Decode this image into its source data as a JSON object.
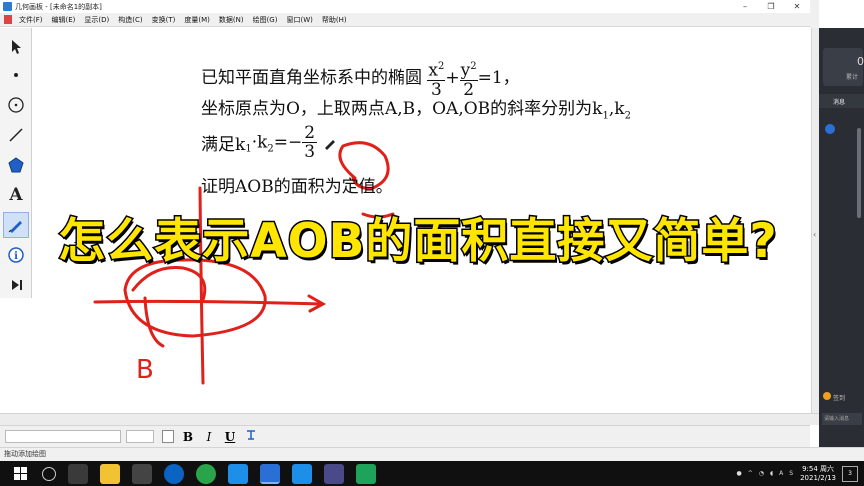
{
  "window": {
    "title": "几何画板 - [未命名1的副本]",
    "controls": [
      "–",
      "❐",
      "✕"
    ]
  },
  "menu": [
    "文件(F)",
    "编辑(E)",
    "显示(D)",
    "构造(C)",
    "变换(T)",
    "度量(M)",
    "数据(N)",
    "绘图(G)",
    "窗口(W)",
    "帮助(H)"
  ],
  "toolbox": {
    "tools": [
      "arrow-select",
      "point",
      "compass-circle",
      "straightedge",
      "polygon",
      "text",
      "marker",
      "information",
      "custom-tools"
    ],
    "active": "marker"
  },
  "problem": {
    "line1": {
      "prefix": "已知平面直角坐标系中的椭圆",
      "frac1_num": "x",
      "frac1_sup": "2",
      "frac1_den": "3",
      "plus": "+",
      "frac2_num": "y",
      "frac2_sup": "2",
      "frac2_den": "2",
      "suffix": "=1，"
    },
    "line2": {
      "text": "坐标原点为O，上取两点A,B，OA,OB的斜率分别为k",
      "sub1": "1",
      "comma": ",k",
      "sub2": "2"
    },
    "line3": {
      "prefix": "满足k",
      "sub1": "1",
      "mid": "·k",
      "sub2": "2",
      "eq": "=−",
      "frac_num": "2",
      "frac_den": "3"
    },
    "line4": "证明AOB的面积为定值。"
  },
  "banner": "怎么表示AOB的面积直接又简单?",
  "sketch": {
    "label": "B",
    "stroke_color": "#e0201a"
  },
  "textbar": {
    "bold": "B",
    "italic": "I",
    "underline": "U"
  },
  "status": "拖动添加绘图",
  "side_panel": {
    "big_number": "0",
    "subtitle": "累计",
    "tab": "消息",
    "sign_in": "签到",
    "input_placeholder": "请输入消息"
  },
  "taskbar": {
    "clock_time": "9:54 周六",
    "clock_date": "2021/2/13",
    "notifications": "3",
    "tray_lang": "A",
    "tray_ime": "S"
  },
  "colors": {
    "banner_fill": "#ffe600",
    "banner_stroke": "#000000",
    "ink": "#e0201a",
    "active_tool": "#cfe0f7"
  }
}
